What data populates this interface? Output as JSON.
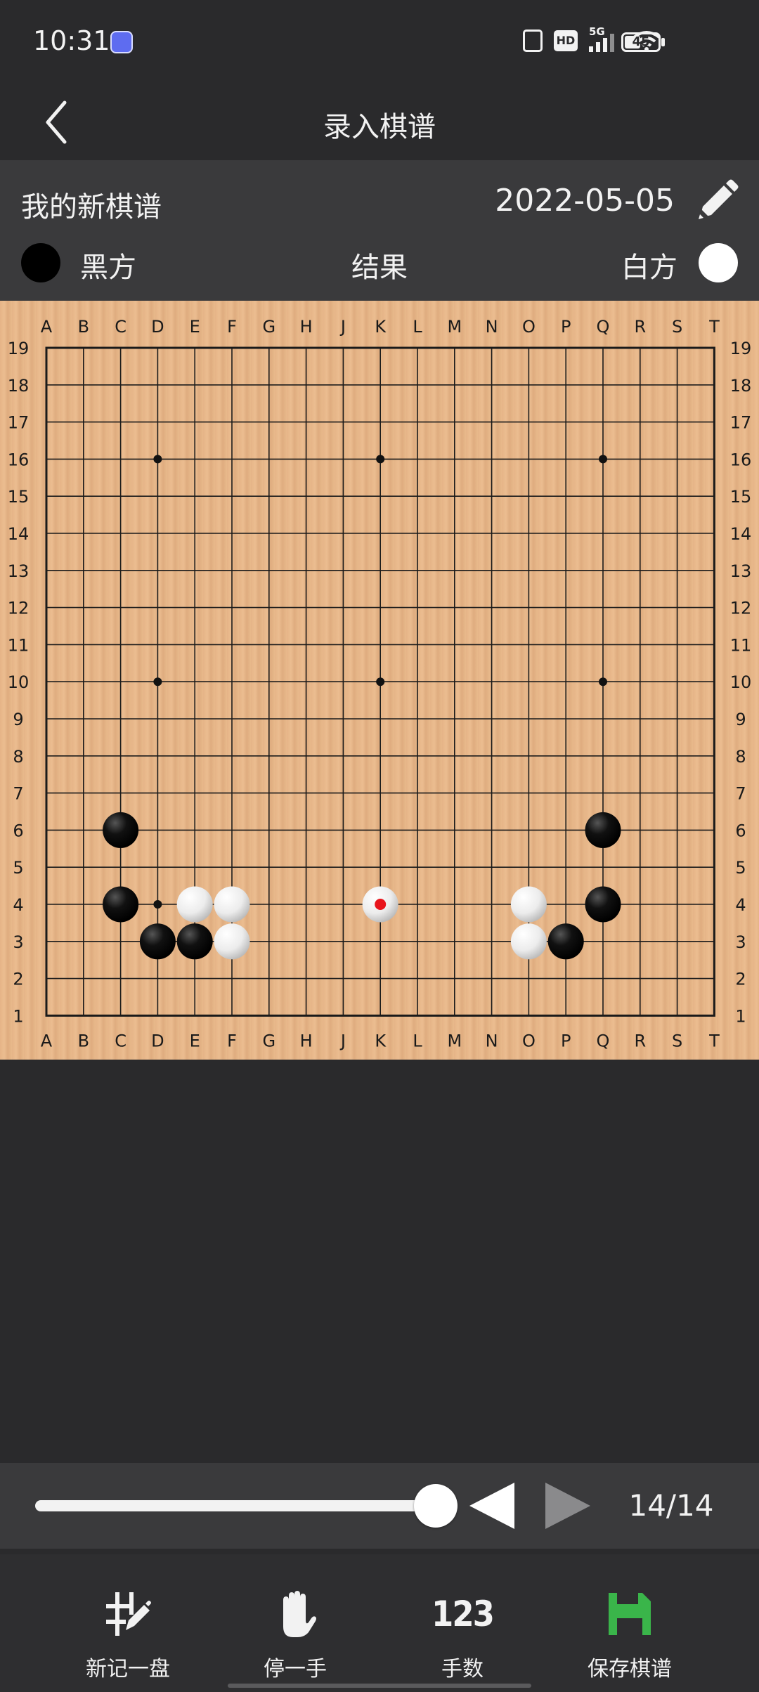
{
  "status_bar": {
    "time": "10:31",
    "network": "5G",
    "hd_label": "HD",
    "battery": "45"
  },
  "nav": {
    "title": "录入棋谱",
    "back_icon": "chevron-left-icon"
  },
  "record": {
    "name": "我的新棋谱",
    "date": "2022-05-05",
    "black_label": "黑方",
    "result_label": "结果",
    "white_label": "白方"
  },
  "board": {
    "size": 19,
    "columns": [
      "A",
      "B",
      "C",
      "D",
      "E",
      "F",
      "G",
      "H",
      "J",
      "K",
      "L",
      "M",
      "N",
      "O",
      "P",
      "Q",
      "R",
      "S",
      "T"
    ],
    "rows": [
      "19",
      "18",
      "17",
      "16",
      "15",
      "14",
      "13",
      "12",
      "11",
      "10",
      "9",
      "8",
      "7",
      "6",
      "5",
      "4",
      "3",
      "2",
      "1"
    ],
    "star_points": [
      "D16",
      "K16",
      "Q16",
      "D10",
      "K10",
      "Q10",
      "D4",
      "K4",
      "Q4"
    ],
    "stones": [
      {
        "color": "black",
        "point": "C6"
      },
      {
        "color": "black",
        "point": "C4"
      },
      {
        "color": "black",
        "point": "D3"
      },
      {
        "color": "black",
        "point": "E3"
      },
      {
        "color": "white",
        "point": "E4"
      },
      {
        "color": "white",
        "point": "F4"
      },
      {
        "color": "white",
        "point": "F3"
      },
      {
        "color": "white",
        "point": "K4"
      },
      {
        "color": "white",
        "point": "O4"
      },
      {
        "color": "white",
        "point": "O3"
      },
      {
        "color": "black",
        "point": "P3"
      },
      {
        "color": "black",
        "point": "Q4"
      },
      {
        "color": "black",
        "point": "Q6"
      }
    ],
    "last_move": "K4",
    "last_move_marker_color": "#e8141c"
  },
  "controls": {
    "current_move": 14,
    "total_moves": 14,
    "move_counter": "14/14",
    "progress": 1.0,
    "prev_icon": "triangle-left-icon",
    "next_icon": "triangle-right-icon"
  },
  "toolbar": {
    "items": [
      {
        "label": "新记一盘",
        "icon": "new-board-icon"
      },
      {
        "label": "停一手",
        "icon": "hand-icon"
      },
      {
        "label": "手数",
        "icon": "numbers-icon",
        "icon_text": "123"
      },
      {
        "label": "保存棋谱",
        "icon": "save-icon",
        "icon_color": "#3ab54a"
      }
    ]
  }
}
